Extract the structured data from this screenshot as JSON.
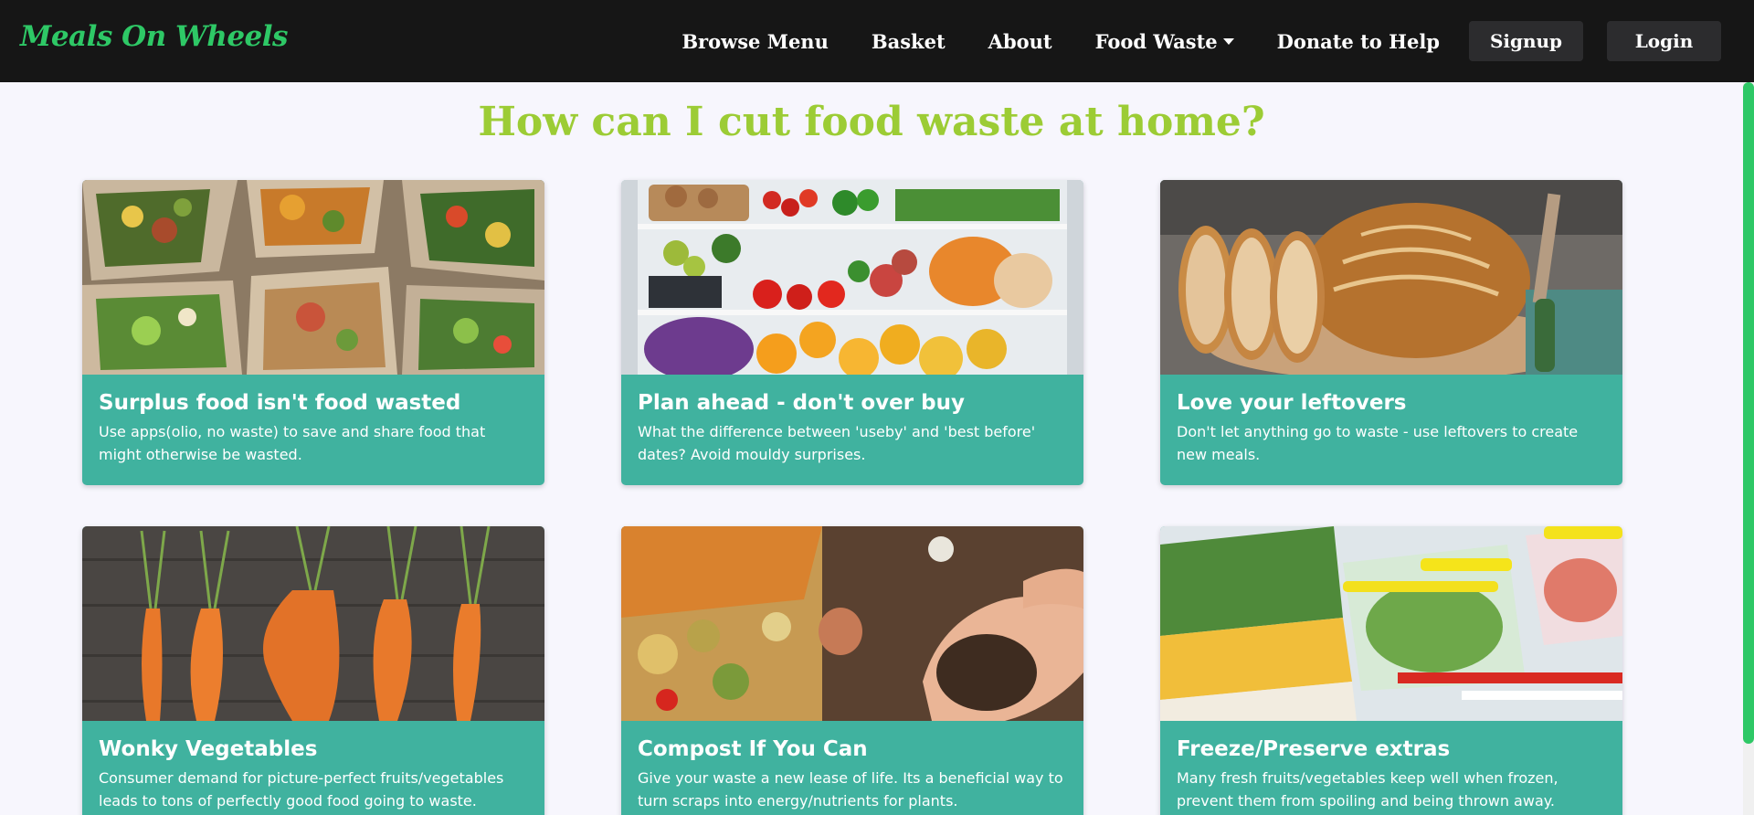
{
  "brand": "Meals On Wheels",
  "nav": {
    "browse_menu": "Browse Menu",
    "basket": "Basket",
    "about": "About",
    "food_waste": "Food Waste",
    "donate": "Donate to Help",
    "signup": "Signup",
    "login": "Login"
  },
  "page_title": "How can I cut food waste at home?",
  "cards": [
    {
      "title": "Surplus food isn't food wasted",
      "text": "Use apps(olio, no waste) to save and share food that might otherwise be wasted.",
      "image": "takeaway-boxes-image"
    },
    {
      "title": "Plan ahead - don't over buy",
      "text": "What the difference between 'useby' and 'best before' dates? Avoid mouldy surprises.",
      "image": "fridge-produce-image"
    },
    {
      "title": "Love your leftovers",
      "text": "Don't let anything go to waste - use leftovers to create new meals.",
      "image": "bread-loaf-image"
    },
    {
      "title": "Wonky Vegetables",
      "text": "Consumer demand for picture-perfect fruits/vegetables leads to tons of perfectly good food going to waste.",
      "image": "wonky-carrots-image"
    },
    {
      "title": "Compost If You Can",
      "text": "Give your waste a new lease of life. Its a beneficial way to turn scraps into energy/nutrients for plants.",
      "image": "compost-hands-image"
    },
    {
      "title": "Freeze/Preserve extras",
      "text": "Many fresh fruits/vegetables keep well when frozen, prevent them from spoiling and being thrown away.",
      "image": "frozen-food-image"
    }
  ],
  "colors": {
    "navbar": "#161616",
    "brand": "#2ec866",
    "title": "#9ccc35",
    "card": "#40b29f",
    "background": "#f7f6fd"
  }
}
